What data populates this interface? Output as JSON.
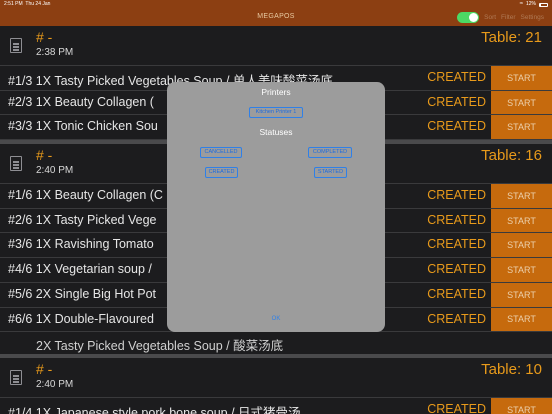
{
  "status_bar": {
    "time": "2:51 PM",
    "date": "Thu 24 Jan",
    "battery": "12%"
  },
  "nav": {
    "title": "MEGAPOS",
    "sort": "Sort",
    "filter": "Filter",
    "settings": "Settings"
  },
  "orders": [
    {
      "number": "# -",
      "time": "2:38 PM",
      "table": "Table: 21",
      "items": [
        {
          "text": "#1/3 1X Tasty Picked Vegetables Soup / 单人美味酸菜汤底",
          "status": "CREATED",
          "button": "START"
        },
        {
          "text": "#2/3 1X Beauty Collagen (",
          "status": "CREATED",
          "button": "START"
        },
        {
          "text": "#3/3 1X Tonic Chicken Sou",
          "status": "CREATED",
          "button": "START"
        }
      ]
    },
    {
      "number": "# -",
      "time": "2:40 PM",
      "table": "Table: 16",
      "items": [
        {
          "text": "#1/6 1X Beauty Collagen (C",
          "status": "CREATED",
          "button": "START"
        },
        {
          "text": "#2/6 1X Tasty Picked Vege",
          "status": "CREATED",
          "button": "START"
        },
        {
          "text": "#3/6 1X Ravishing Tomato",
          "status": "CREATED",
          "button": "START"
        },
        {
          "text": "#4/6 1X Vegetarian soup /",
          "status": "CREATED",
          "button": "START"
        },
        {
          "text": "#5/6 2X Single Big Hot Pot",
          "status": "CREATED",
          "button": "START"
        },
        {
          "text": "#6/6 1X Double-Flavoured",
          "status": "CREATED",
          "button": "START"
        }
      ],
      "subitem": "2X Tasty Picked Vegetables Soup / 酸菜汤底"
    },
    {
      "number": "# -",
      "time": "2:40 PM",
      "table": "Table: 10",
      "items": [
        {
          "text": "#1/4 1X Japanese style pork bone soup / 日式猪骨汤",
          "status": "CREATED",
          "button": "START"
        }
      ]
    }
  ],
  "modal": {
    "printers_title": "Printers",
    "printer": "Kitchen Printer 1",
    "statuses_title": "Statuses",
    "statuses": [
      "CANCELLED",
      "COMPLETED",
      "CREATED",
      "STARTED"
    ],
    "ok": "OK"
  }
}
